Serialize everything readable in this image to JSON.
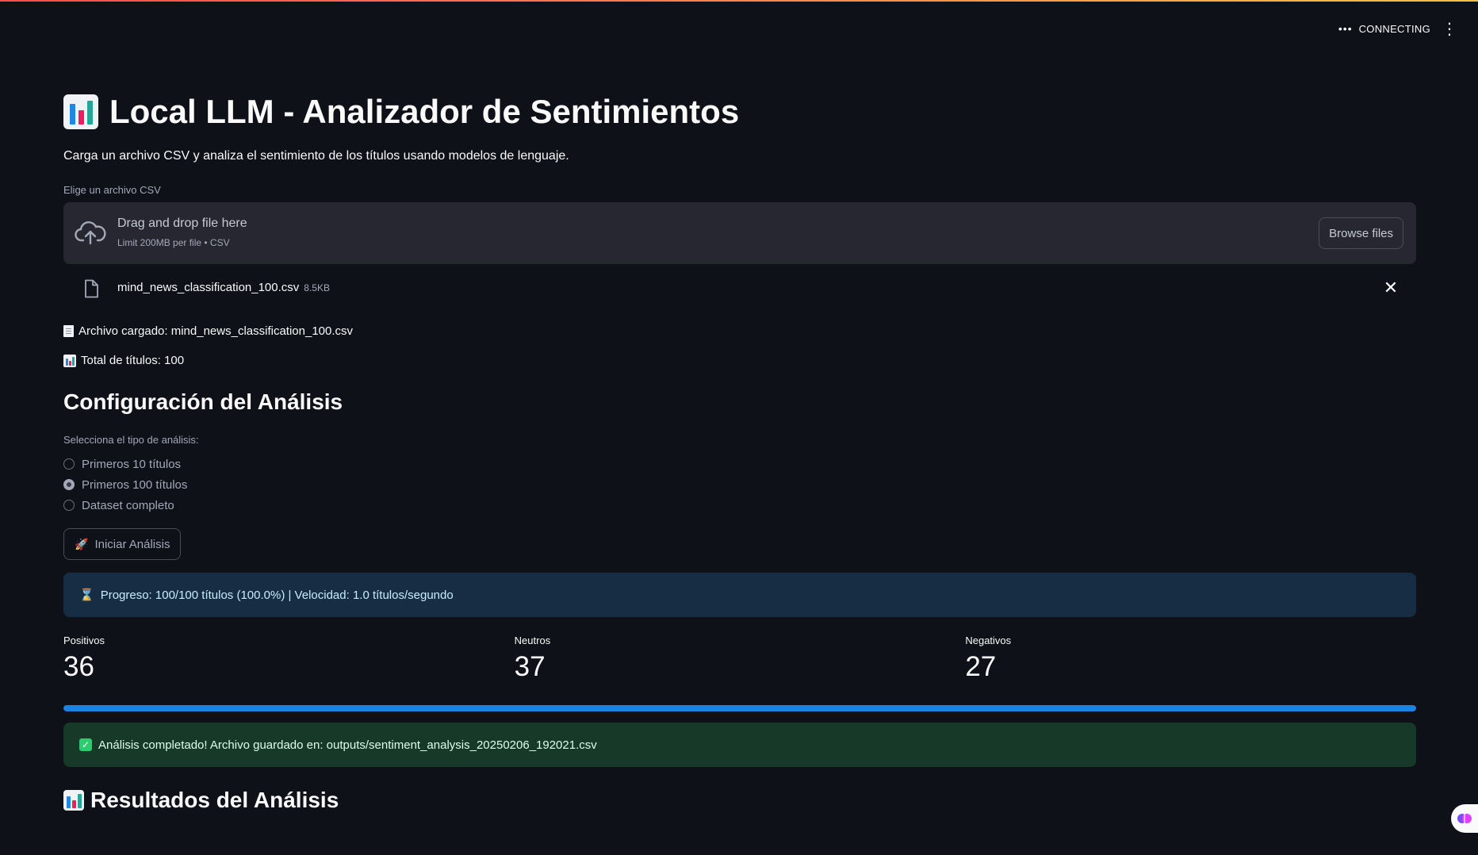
{
  "header": {
    "status_dots": "•••",
    "status_text": "CONNECTING",
    "menu_icon": "vertical-dots-icon"
  },
  "title": {
    "icon": "bar-chart-icon",
    "text": "Local LLM - Analizador de Sentimientos"
  },
  "subtitle": "Carga un archivo CSV y analiza el sentimiento de los títulos usando modelos de lenguaje.",
  "uploader": {
    "label": "Elige un archivo CSV",
    "main_text": "Drag and drop file here",
    "limit_text": "Limit 200MB per file • CSV",
    "browse_label": "Browse files",
    "icon": "cloud-upload-icon"
  },
  "uploaded_file": {
    "name": "mind_news_classification_100.csv",
    "size": "8.5KB",
    "icon": "file-icon",
    "close": "✕"
  },
  "info": {
    "file_loaded": "Archivo cargado: mind_news_classification_100.csv",
    "total_titles": "Total de títulos: 100"
  },
  "config": {
    "heading": "Configuración del Análisis",
    "radio_label": "Selecciona el tipo de análisis:",
    "options": [
      {
        "label": "Primeros 10 títulos",
        "checked": false
      },
      {
        "label": "Primeros 100 títulos",
        "checked": true
      },
      {
        "label": "Dataset completo",
        "checked": false
      }
    ],
    "start_button": "Iniciar Análisis",
    "start_icon": "rocket-icon"
  },
  "progress_alert": {
    "icon": "hourglass-icon",
    "text": "Progreso: 100/100 títulos (100.0%) | Velocidad: 1.0 títulos/segundo"
  },
  "metrics": [
    {
      "label": "Positivos",
      "value": "36"
    },
    {
      "label": "Neutros",
      "value": "37"
    },
    {
      "label": "Negativos",
      "value": "27"
    }
  ],
  "progress": {
    "value": 1.0
  },
  "success_alert": {
    "icon": "check-box-icon",
    "text": "Análisis completado! Archivo guardado en: outputs/sentiment_analysis_20250206_192021.csv"
  },
  "results_heading": "Resultados del Análisis",
  "colors": {
    "background": "#0e1117",
    "info_bg": "#172d43",
    "success_bg": "#173928",
    "progress": "#1c83e1",
    "accent": "#ff4b4b"
  }
}
